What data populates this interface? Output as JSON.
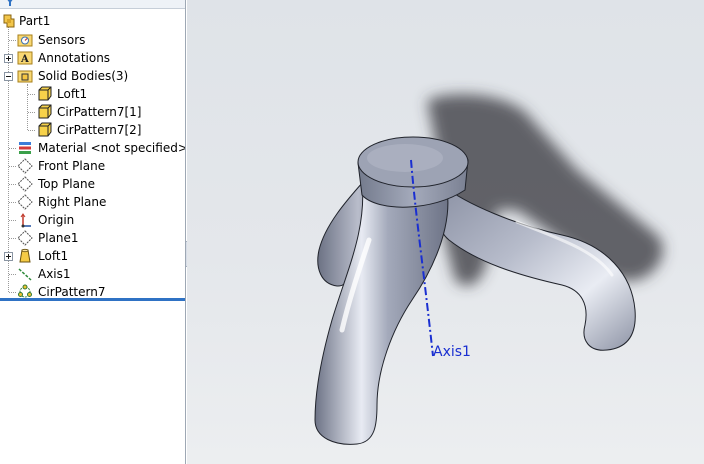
{
  "tree": {
    "root": {
      "label": "Part1",
      "icon": "part-icon"
    },
    "items": [
      {
        "label": "Sensors",
        "icon": "sensors-folder-icon"
      },
      {
        "label": "Annotations",
        "icon": "annotations-folder-icon"
      },
      {
        "label": "Solid Bodies(3)",
        "icon": "solid-bodies-folder-icon"
      },
      {
        "label": "Loft1",
        "icon": "solid-body-icon"
      },
      {
        "label": "CirPattern7[1]",
        "icon": "solid-body-icon"
      },
      {
        "label": "CirPattern7[2]",
        "icon": "solid-body-icon"
      },
      {
        "label": "Material <not specified>",
        "icon": "material-icon"
      },
      {
        "label": "Front Plane",
        "icon": "plane-icon"
      },
      {
        "label": "Top Plane",
        "icon": "plane-icon"
      },
      {
        "label": "Right Plane",
        "icon": "plane-icon"
      },
      {
        "label": "Origin",
        "icon": "origin-icon"
      },
      {
        "label": "Plane1",
        "icon": "plane-icon"
      },
      {
        "label": "Loft1",
        "icon": "loft-feature-icon"
      },
      {
        "label": "Axis1",
        "icon": "axis-icon"
      },
      {
        "label": "CirPattern7",
        "icon": "circular-pattern-icon"
      }
    ]
  },
  "viewport": {
    "axis_label": "Axis1",
    "model": "three-leg-loft-body"
  },
  "colors": {
    "rollback_bar": "#2f72c4",
    "axis": "#1a2fd1",
    "model_face": "#8f96a8"
  }
}
